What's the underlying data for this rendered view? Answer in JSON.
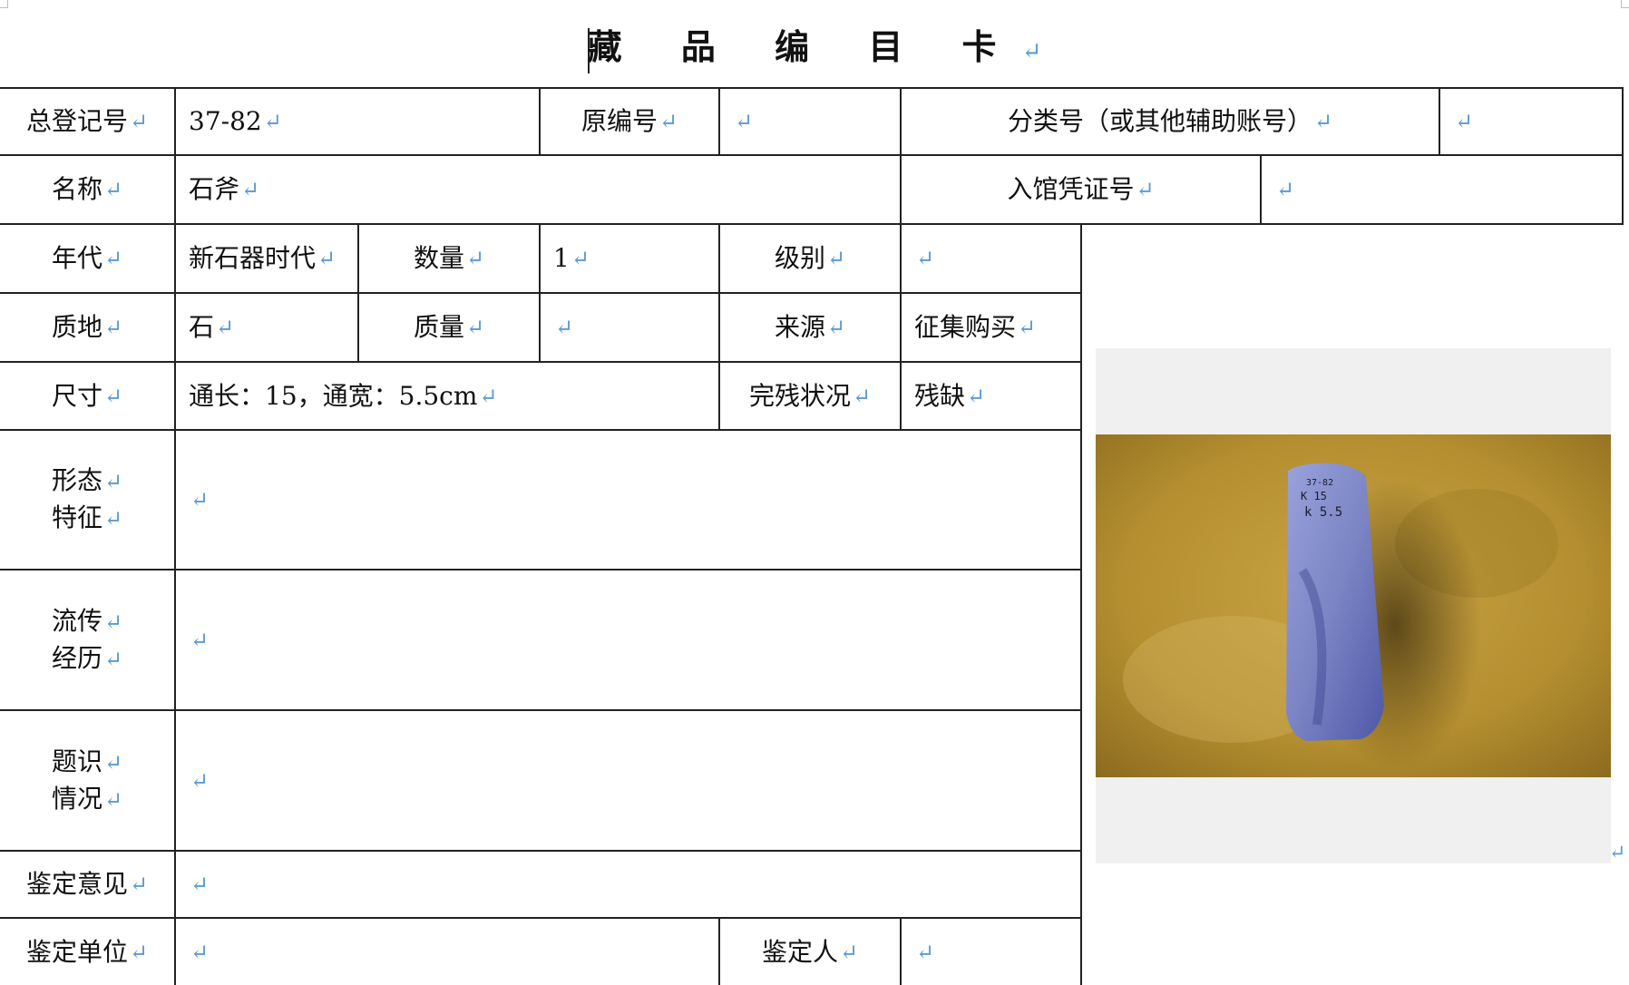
{
  "title": "藏 品 编 目 卡",
  "paragraph_mark": "↵",
  "row1": {
    "label_reg": "总登记号",
    "reg_no": "37-82",
    "label_orig": "原编号",
    "orig_no": "",
    "label_class": "分类号（或其他辅助账号）",
    "class_no": ""
  },
  "row2": {
    "label_name": "名称",
    "name": "石斧",
    "label_voucher": "入馆凭证号",
    "voucher_no": ""
  },
  "row3": {
    "label_era": "年代",
    "era": "新石器时代",
    "label_qty": "数量",
    "qty": "1",
    "label_grade": "级别",
    "grade": ""
  },
  "row4": {
    "label_material": "质地",
    "material": "石",
    "label_mass": "质量",
    "mass": "",
    "label_source": "来源",
    "source": "征集购买"
  },
  "row5": {
    "label_size": "尺寸",
    "size": "通长：15，通宽：5.5cm",
    "label_condition": "完残状况",
    "condition": "残缺"
  },
  "row6": {
    "label_a": "形态",
    "label_b": "特征",
    "value": ""
  },
  "row7": {
    "label_a": "流传",
    "label_b": "经历",
    "value": ""
  },
  "row8": {
    "label_a": "题识",
    "label_b": "情况",
    "value": ""
  },
  "row9": {
    "label": "鉴定意见",
    "value": ""
  },
  "row10": {
    "label_unit": "鉴定单位",
    "unit": "",
    "label_person": "鉴定人",
    "person": ""
  },
  "photo": {
    "inscription_1": "37-82",
    "inscription_2": "K 15",
    "inscription_3": "k 5.5"
  },
  "colors": {
    "border": "#222222",
    "para_mark": "#5b9bd5",
    "photo_bg": "#b8922e",
    "axe": "#7b84c4"
  }
}
